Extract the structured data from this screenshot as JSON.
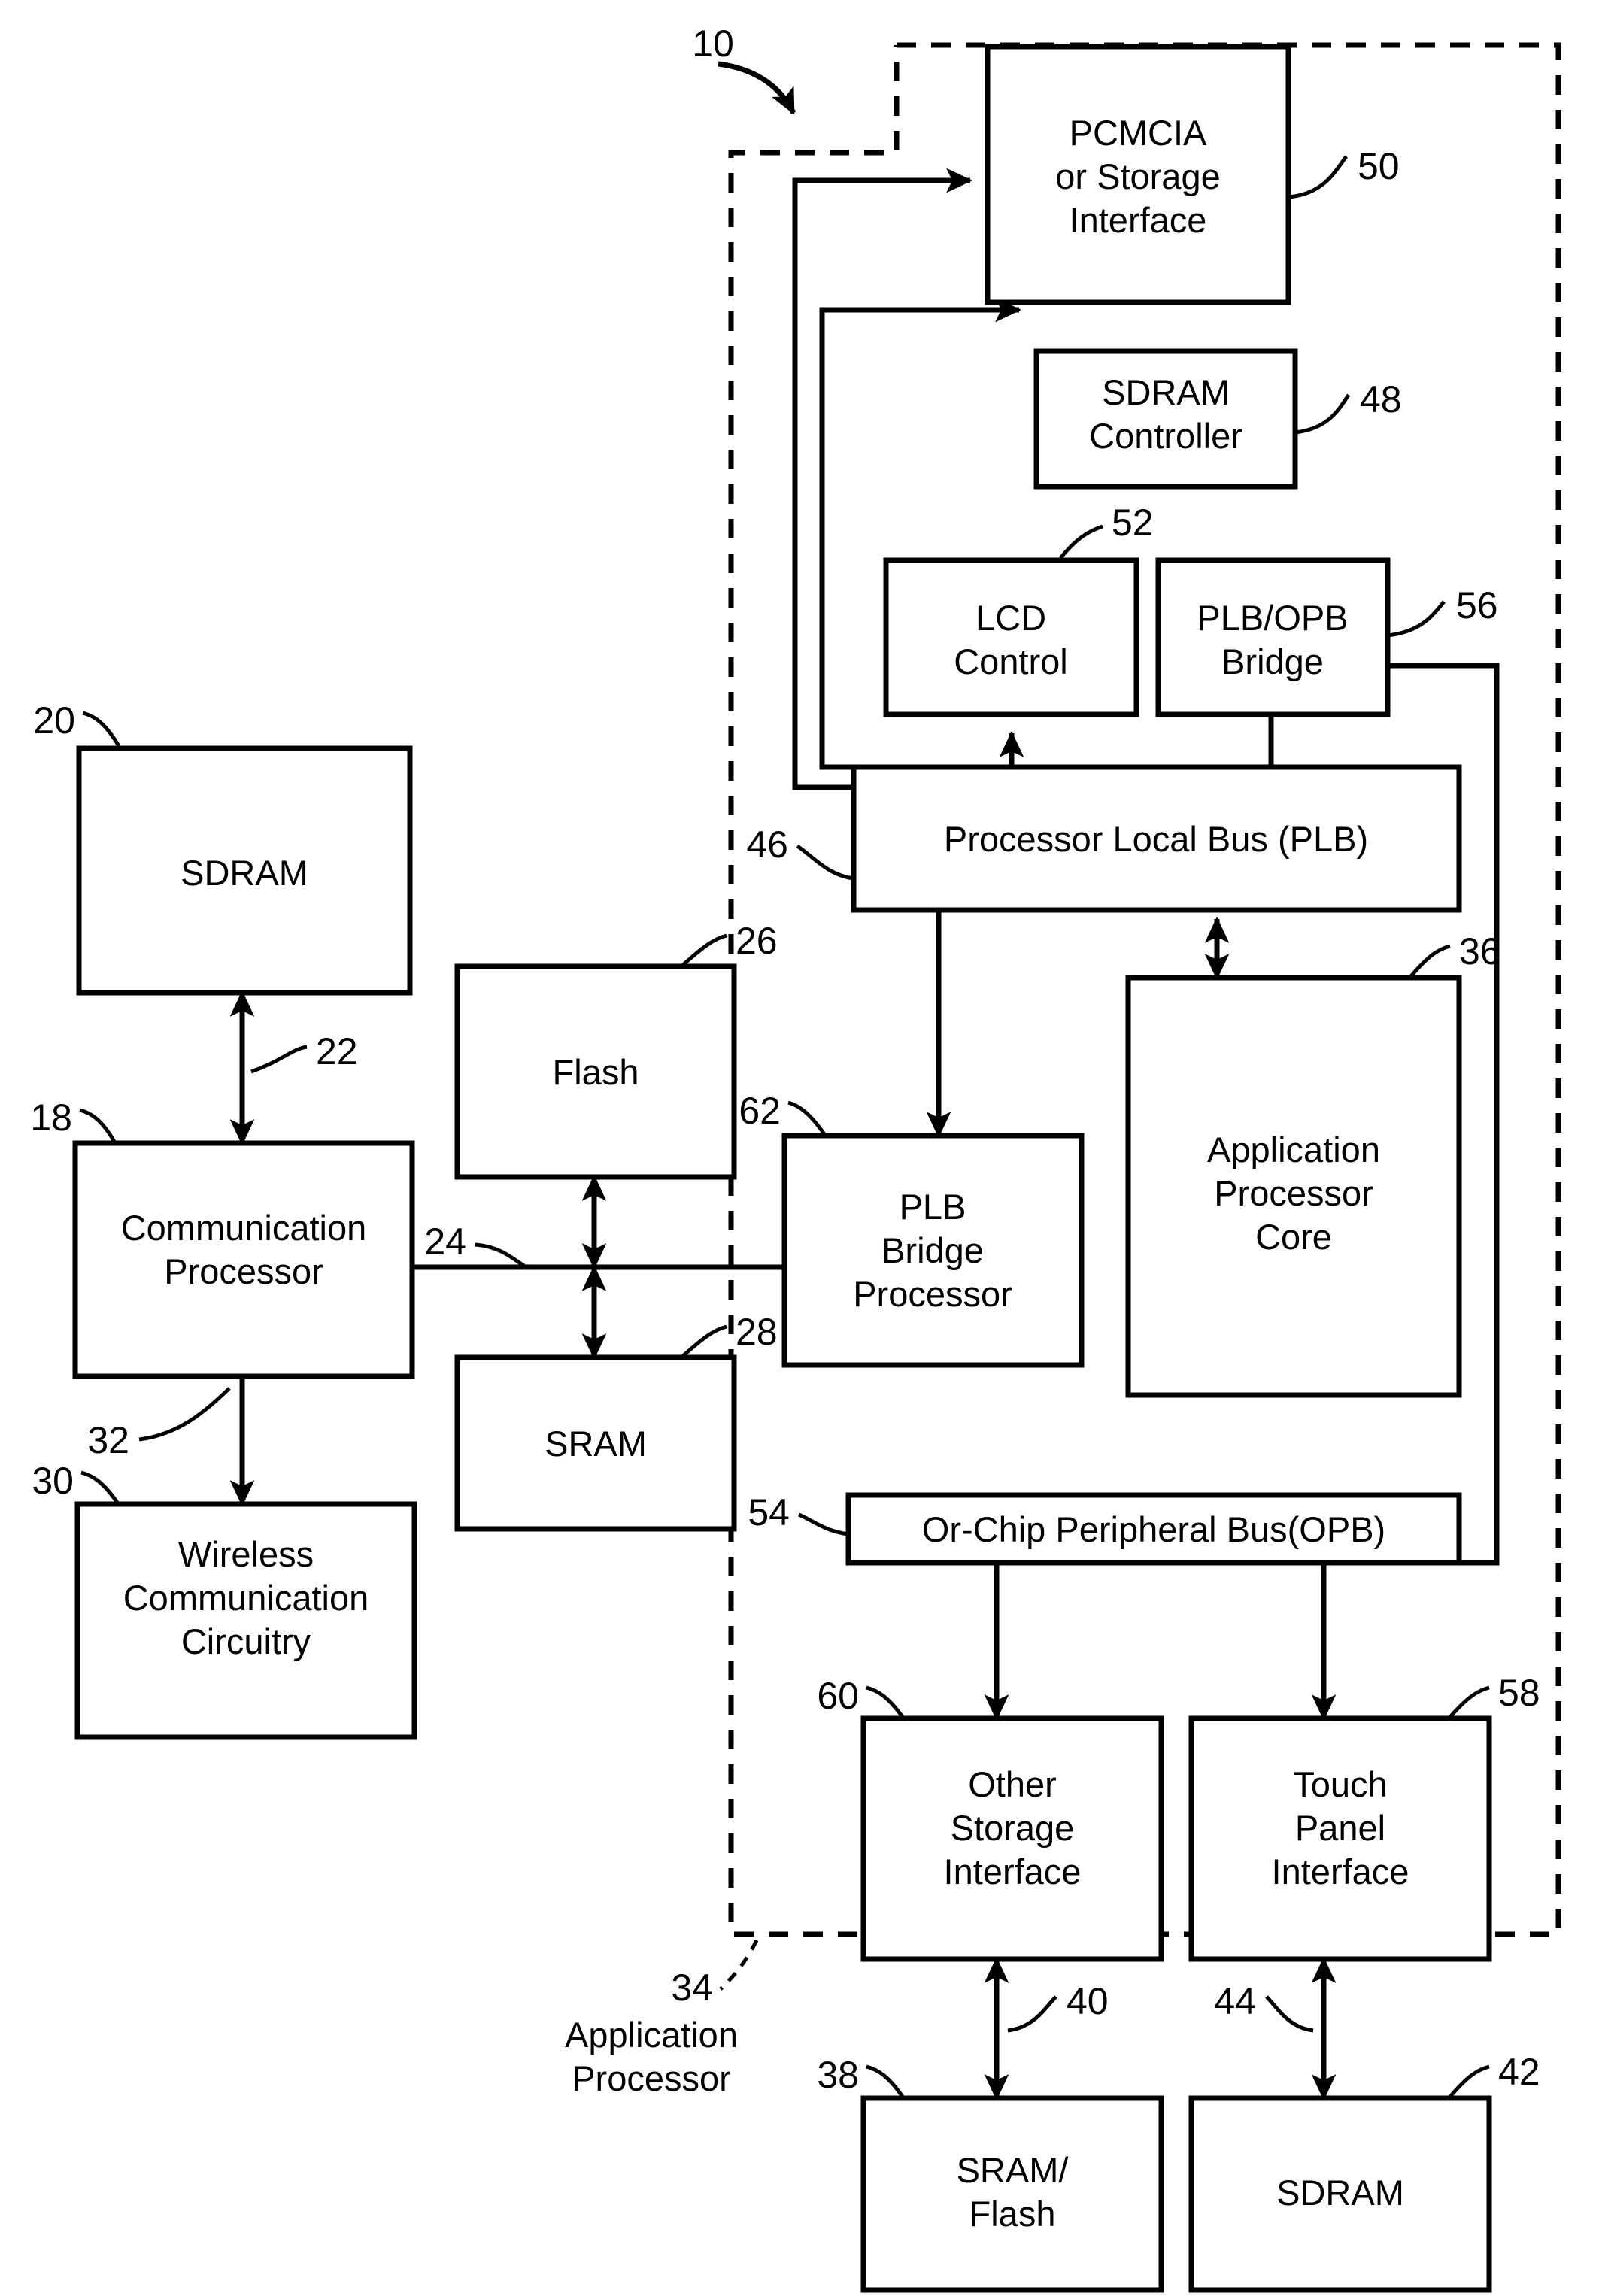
{
  "figure": {
    "figure_ref": "10",
    "group_label": {
      "ref": "34",
      "line1": "Application",
      "line2": "Processor"
    }
  },
  "blocks": [
    {
      "id": "pcmcia",
      "ref": "50",
      "lines": [
        "PCMCIA",
        "or Storage",
        "Interface"
      ]
    },
    {
      "id": "sdram_ctrl",
      "ref": "48",
      "lines": [
        "SDRAM",
        "Controller"
      ]
    },
    {
      "id": "lcd",
      "ref": "52",
      "lines": [
        "LCD",
        "Control"
      ]
    },
    {
      "id": "plb_opb",
      "ref": "56",
      "lines": [
        "PLB/OPB",
        "Bridge"
      ]
    },
    {
      "id": "plb",
      "ref": "46",
      "lines": [
        "Processor Local Bus (PLB)"
      ]
    },
    {
      "id": "sdram20",
      "ref": "20",
      "lines": [
        "SDRAM"
      ]
    },
    {
      "id": "commproc",
      "ref": "18",
      "lines": [
        "Communication",
        "Processor"
      ]
    },
    {
      "id": "wireless",
      "ref": "30",
      "lines": [
        "Wireless",
        "Communication",
        "Circuitry"
      ]
    },
    {
      "id": "flash",
      "ref": "26",
      "lines": [
        "Flash"
      ]
    },
    {
      "id": "sram",
      "ref": "28",
      "lines": [
        "SRAM"
      ]
    },
    {
      "id": "plbbridge",
      "ref": "62",
      "lines": [
        "PLB",
        "Bridge",
        "Processor"
      ]
    },
    {
      "id": "appcore",
      "ref": "36",
      "lines": [
        "Application",
        "Processor",
        "Core"
      ]
    },
    {
      "id": "opb",
      "ref": "54",
      "lines": [
        "Or-Chip Peripheral Bus(OPB)"
      ]
    },
    {
      "id": "otherstore",
      "ref": "60",
      "lines": [
        "Other",
        "Storage",
        "Interface"
      ]
    },
    {
      "id": "touch",
      "ref": "58",
      "lines": [
        "Touch",
        "Panel",
        "Interface"
      ]
    },
    {
      "id": "sramflash",
      "ref": "38",
      "lines": [
        "SRAM/",
        "Flash"
      ]
    },
    {
      "id": "sdram42",
      "ref": "42",
      "lines": [
        "SDRAM"
      ]
    }
  ],
  "connector_refs": [
    {
      "id": "c22",
      "ref": "22"
    },
    {
      "id": "c24",
      "ref": "24"
    },
    {
      "id": "c32",
      "ref": "32"
    },
    {
      "id": "c40",
      "ref": "40"
    },
    {
      "id": "c44",
      "ref": "44"
    }
  ],
  "colors": {
    "ink": "#000000",
    "paper": "#ffffff"
  }
}
